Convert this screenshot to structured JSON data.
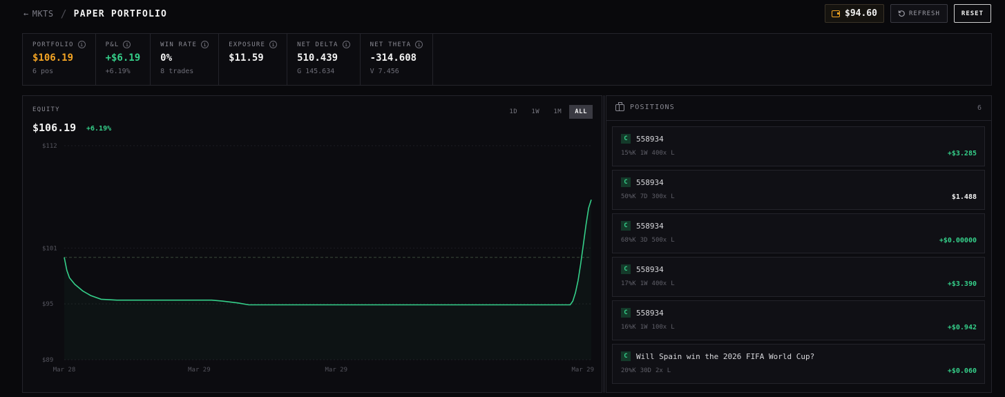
{
  "header": {
    "back_label": "MKTS",
    "separator": "/",
    "title": "PAPER PORTFOLIO",
    "cash": "$94.60",
    "refresh_label": "REFRESH",
    "reset_label": "RESET"
  },
  "stats": [
    {
      "label": "PORTFOLIO",
      "value": "$106.19",
      "sub": "6 pos",
      "tone": "orange"
    },
    {
      "label": "P&L",
      "value": "+$6.19",
      "sub": "+6.19%",
      "tone": "green"
    },
    {
      "label": "WIN RATE",
      "value": "0%",
      "sub": "8 trades",
      "tone": ""
    },
    {
      "label": "EXPOSURE",
      "value": "$11.59",
      "sub": "",
      "tone": ""
    },
    {
      "label": "NET DELTA",
      "value": "510.439",
      "sub": "G 145.634",
      "tone": ""
    },
    {
      "label": "NET THETA",
      "value": "-314.608",
      "sub": "V 7.456",
      "tone": ""
    }
  ],
  "equity": {
    "label": "EQUITY",
    "value": "$106.19",
    "change": "+6.19%",
    "timeframes": [
      "1D",
      "1W",
      "1M",
      "ALL"
    ],
    "active_timeframe": "ALL"
  },
  "chart_data": {
    "type": "line",
    "y_ticks": [
      "$112",
      "$101",
      "$95",
      "$89"
    ],
    "y_tick_values": [
      112,
      101,
      95,
      89
    ],
    "x_ticks": [
      "Mar 28",
      "Mar 29",
      "Mar 29",
      "Mar 29"
    ],
    "ylim": [
      89,
      112
    ],
    "baseline": 100,
    "grid": true,
    "series": [
      {
        "x": [
          0,
          0.005,
          0.01,
          0.02,
          0.035,
          0.05,
          0.07,
          0.1,
          0.2,
          0.28,
          0.3,
          0.33,
          0.35,
          0.5,
          0.7,
          0.96,
          0.965,
          0.97,
          0.975,
          0.98,
          0.985,
          0.99,
          0.995,
          1
        ],
        "y": [
          100,
          98.6,
          97.8,
          97.1,
          96.4,
          95.9,
          95.5,
          95.4,
          95.4,
          95.4,
          95.3,
          95.1,
          94.9,
          94.9,
          94.9,
          94.9,
          95.3,
          96.2,
          97.5,
          99.3,
          101.4,
          103.5,
          105.3,
          106.19
        ],
        "color": "#35d08a"
      }
    ]
  },
  "positions": {
    "title": "POSITIONS",
    "count": "6",
    "items": [
      {
        "badge": "C",
        "name": "558934",
        "meta": [
          "15%K",
          "1W",
          "400x",
          "L"
        ],
        "pnl": "+$3.285",
        "tone": "green"
      },
      {
        "badge": "C",
        "name": "558934",
        "meta": [
          "50%K",
          "7D",
          "300x",
          "L"
        ],
        "pnl": "$1.488",
        "tone": "neutral"
      },
      {
        "badge": "C",
        "name": "558934",
        "meta": [
          "68%K",
          "3D",
          "500x",
          "L"
        ],
        "pnl": "+$0.00000",
        "tone": "green"
      },
      {
        "badge": "C",
        "name": "558934",
        "meta": [
          "17%K",
          "1W",
          "400x",
          "L"
        ],
        "pnl": "+$3.390",
        "tone": "green"
      },
      {
        "badge": "C",
        "name": "558934",
        "meta": [
          "16%K",
          "1W",
          "100x",
          "L"
        ],
        "pnl": "+$0.942",
        "tone": "green"
      },
      {
        "badge": "C",
        "name": "Will Spain win the 2026 FIFA World Cup?",
        "meta": [
          "20%K",
          "30D",
          "2x",
          "L"
        ],
        "pnl": "+$0.060",
        "tone": "green"
      }
    ]
  },
  "colors": {
    "accent": "#f5a524",
    "positive": "#35d08a",
    "background": "#09090c",
    "panel": "#0c0c10"
  }
}
